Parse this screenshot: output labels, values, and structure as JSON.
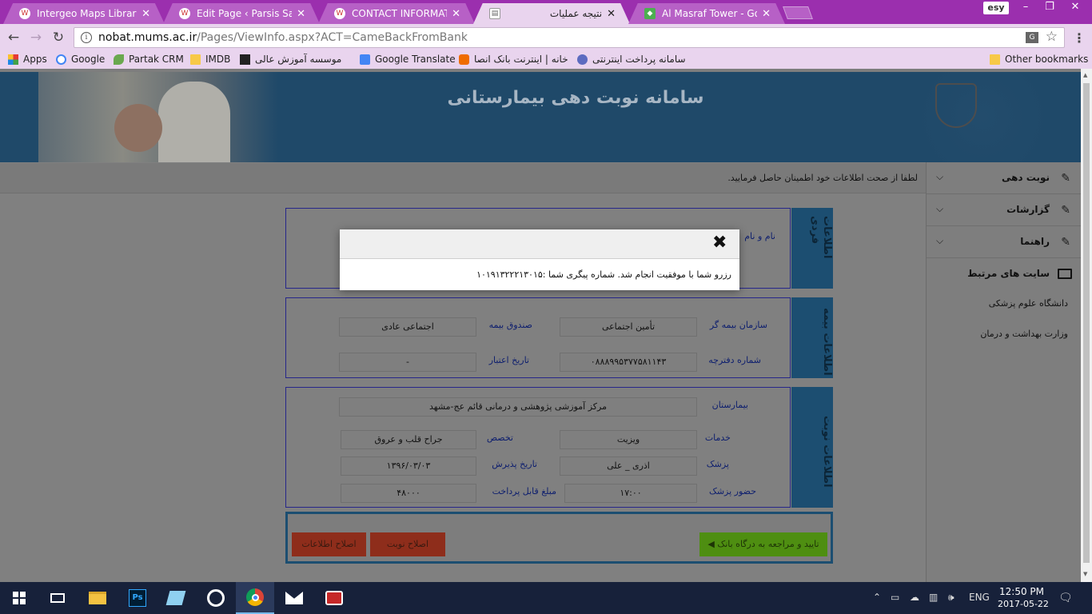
{
  "browser": {
    "tabs": [
      {
        "title": "Intergeo Maps Library ‹ P",
        "active": false
      },
      {
        "title": "Edit Page ‹ Parsis Saffron",
        "active": false
      },
      {
        "title": "CONTACT INFORMATION",
        "active": false
      },
      {
        "title": "نتیجه عملیات",
        "active": true
      },
      {
        "title": "Al Masraf Tower - Google",
        "active": false
      }
    ],
    "profile_badge": "esy",
    "url_domain": "nobat.mums.ac.ir",
    "url_path": "/Pages/ViewInfo.aspx?ACT=CameBackFromBank",
    "bookmarks": [
      {
        "label": "Apps",
        "icon": "apps-grid-icon"
      },
      {
        "label": "Google",
        "icon": "google-icon"
      },
      {
        "label": "Partak CRM",
        "icon": "leaf-icon"
      },
      {
        "label": "IMDB",
        "icon": "folder-icon"
      },
      {
        "label": "موسسه آموزش عالی",
        "icon": "logo-icon"
      },
      {
        "label": "Google Translate",
        "icon": "translate-icon"
      },
      {
        "label": "خانه | اینترنت بانک انصا",
        "icon": "bank-icon"
      },
      {
        "label": "سامانه پرداخت اینترنتی",
        "icon": "globe-icon"
      }
    ],
    "other_bookmarks": "Other bookmarks"
  },
  "banner": {
    "title": "سامانه نوبت دهی بیمارستانی"
  },
  "notice": "لطفا از صحت اطلاعات خود اطمینان حاصل فرمایید.",
  "sidebar": {
    "menu": [
      {
        "label": "نوبت دهی"
      },
      {
        "label": "گزارشات"
      },
      {
        "label": "راهنما"
      }
    ],
    "related_sites_title": "سایت های مرتبط",
    "related_sites": [
      "دانشگاه علوم پزشکی",
      "وزارت بهداشت و درمان"
    ]
  },
  "sections": {
    "personal": {
      "tab": "اطلاعات فردی",
      "name_label": "نام و نام"
    },
    "insurance": {
      "tab": "اطلاعات بیمه",
      "insurer_label": "سازمان بیمه گر",
      "insurer_value": "تأمین اجتماعی",
      "fund_label": "صندوق بیمه",
      "fund_value": "اجتماعی عادی",
      "booklet_label": "شماره دفترچه",
      "booklet_value": "۰۸۸۸۹۹۵۳۷۷۵۸۱۱۴۳",
      "validity_label": "تاریخ اعتبار",
      "validity_value": "-"
    },
    "appointment": {
      "tab": "اطلاعات نوبت",
      "hospital_label": "بیمارستان",
      "hospital_value": "مرکز آموزشی پژوهشی و درمانی قائم عج-مشهد",
      "service_label": "خدمات",
      "service_value": "ویزیت",
      "specialty_label": "تخصص",
      "specialty_value": "جراح قلب و عروق",
      "doctor_label": "پزشک",
      "doctor_value": "اذری _ علی",
      "admission_date_label": "تاریخ پذیرش",
      "admission_date_value": "۱۳۹۶/۰۳/۰۳",
      "attendance_label": "حضور پزشک",
      "attendance_value": "۱۷:۰۰",
      "amount_label": "مبلغ قابل پرداخت",
      "amount_value": "۴۸۰۰۰"
    }
  },
  "actions": {
    "bank_button": "تایید و مراجعه به درگاه بانک",
    "fix_appointment_button": "اصلاح نوبت",
    "fix_info_button": "اصلاح اطلاعات"
  },
  "modal": {
    "message": "رزرو شما با موفقیت انجام شد. شماره پیگری شما :۱۰۱۹۱۳۲۲۲۱۳۰۱۵"
  },
  "taskbar": {
    "language": "ENG",
    "time": "12:50 PM",
    "date": "2017-05-22"
  },
  "colors": {
    "browser_frame": "#9b2fae",
    "banner_bg": "#1f4969",
    "section_tab": "#1c4e71",
    "bank_button": "#4e8e11",
    "fix_button": "#8e2d1b"
  }
}
